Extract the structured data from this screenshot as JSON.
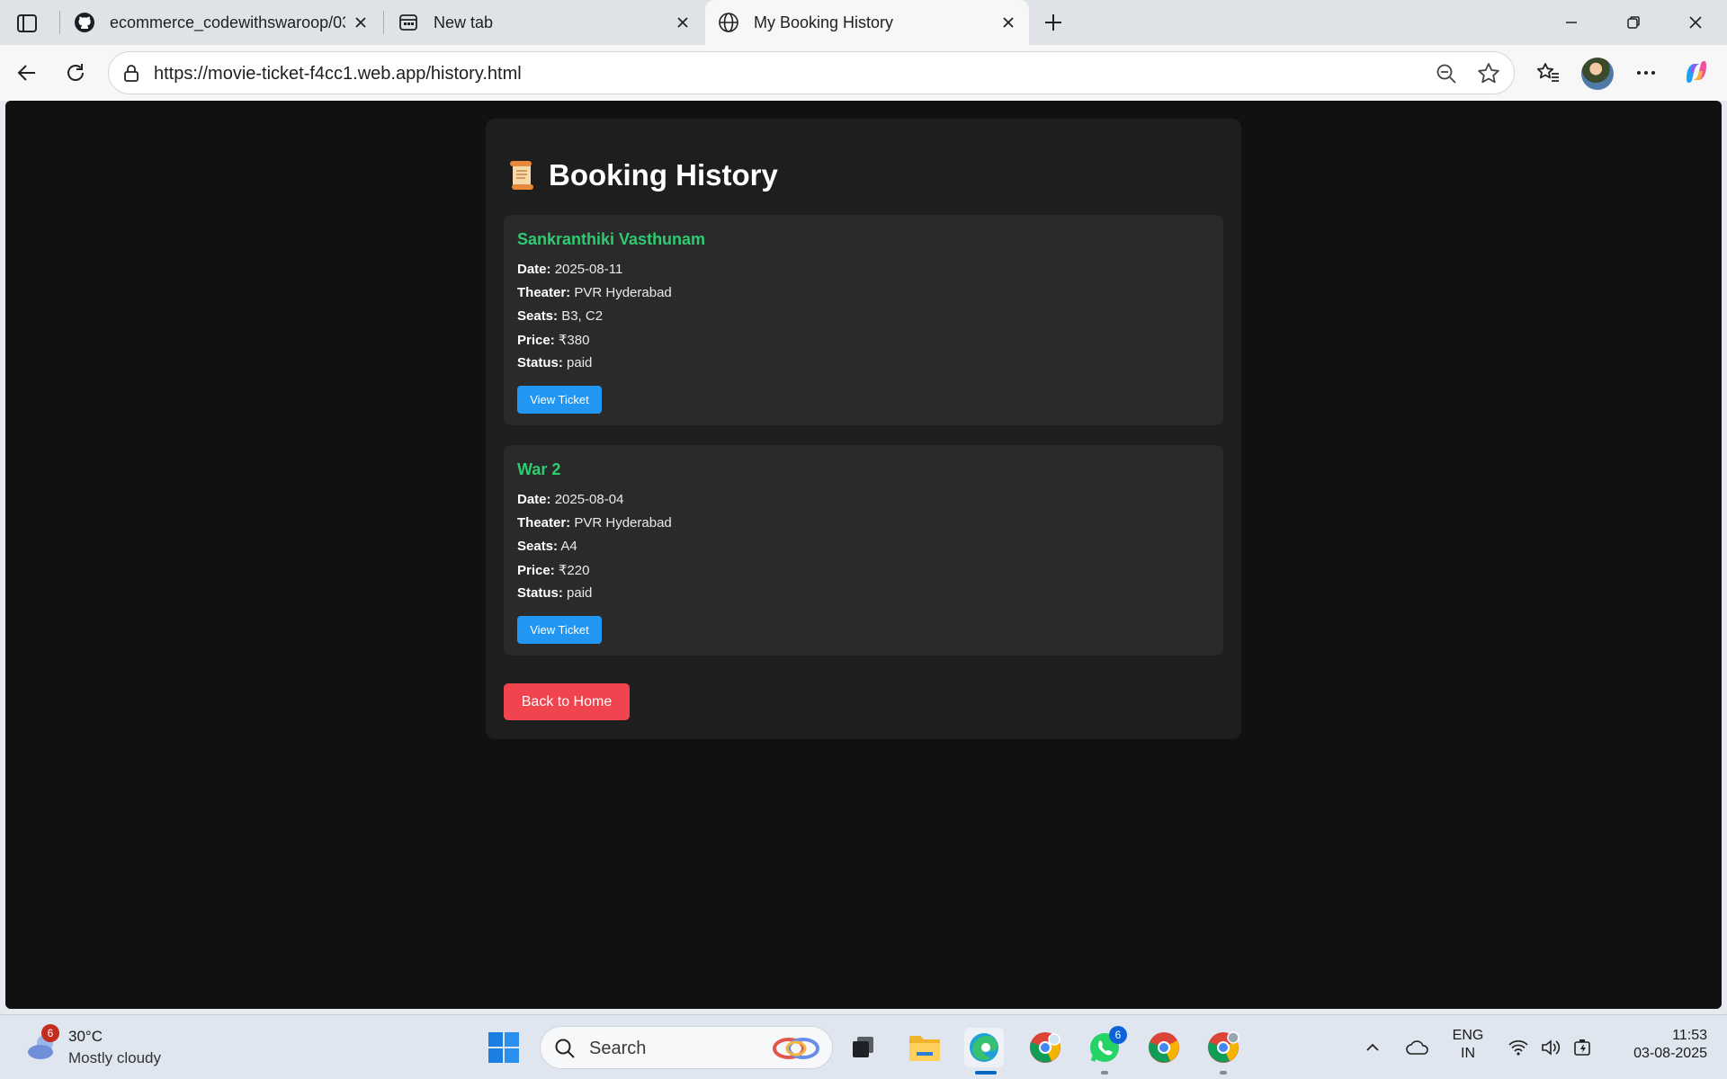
{
  "browser": {
    "tabs": [
      {
        "title": "ecommerce_codewithswaroop/03",
        "icon": "github-icon"
      },
      {
        "title": "New tab",
        "icon": "new-tab-page-icon"
      },
      {
        "title": "My Booking History",
        "icon": "globe-icon",
        "active": true
      }
    ],
    "url": "https://movie-ticket-f4cc1.web.app/history.html"
  },
  "page": {
    "title": "Booking History",
    "title_icon": "scroll-emoji",
    "bookings": [
      {
        "movie": "Sankranthiki Vasthunam",
        "date_label": "Date:",
        "date": "2025-08-11",
        "theater_label": "Theater:",
        "theater": "PVR Hyderabad",
        "seats_label": "Seats:",
        "seats": "B3, C2",
        "price_label": "Price:",
        "price": "₹380",
        "status_label": "Status:",
        "status": "paid",
        "button": "View Ticket"
      },
      {
        "movie": "War 2",
        "date_label": "Date:",
        "date": "2025-08-04",
        "theater_label": "Theater:",
        "theater": "PVR Hyderabad",
        "seats_label": "Seats:",
        "seats": "A4",
        "price_label": "Price:",
        "price": "₹220",
        "status_label": "Status:",
        "status": "paid",
        "button": "View Ticket"
      }
    ],
    "home_button": "Back to Home"
  },
  "taskbar": {
    "weather": {
      "temp": "30°C",
      "condition": "Mostly cloudy",
      "badge": "6"
    },
    "search_label": "Search",
    "whatsapp_badge": "6",
    "lang_top": "ENG",
    "lang_bottom": "IN",
    "time": "11:53",
    "date": "03-08-2025"
  },
  "colors": {
    "movie_title": "#2ecc71",
    "view_ticket": "#2196f3",
    "home_button": "#f0444e",
    "page_bg": "#111111",
    "card_bg": "#2a2a2a"
  }
}
